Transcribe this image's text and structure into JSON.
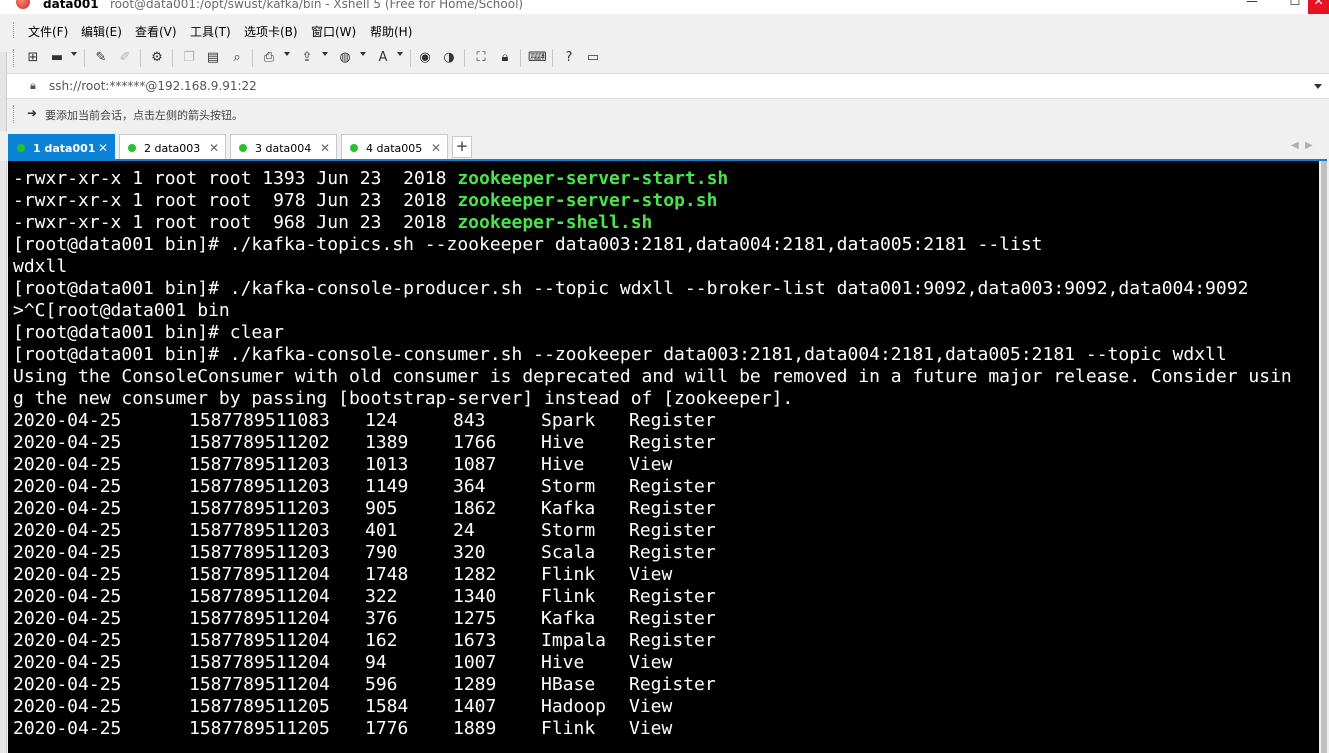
{
  "window": {
    "session_name": "data001",
    "title": "root@data001:/opt/swust/kafka/bin - Xshell 5 (Free for Home/School)",
    "min_label": "—",
    "max_label": "☐",
    "close_label": "✕"
  },
  "menu": [
    "文件(F)",
    "编辑(E)",
    "查看(V)",
    "工具(T)",
    "选项卡(B)",
    "窗口(W)",
    "帮助(H)"
  ],
  "toolbar_icons": [
    "new-session-icon",
    "open-folder-icon",
    "connect-icon",
    "disconnect-icon",
    "session-properties-icon",
    "copy-icon",
    "paste-icon",
    "find-icon",
    "print-icon",
    "transfer-icon",
    "globe-icon",
    "font-icon",
    "script-icon",
    "record-icon",
    "fullscreen-icon",
    "lock-icon",
    "keyboard-icon",
    "help-icon",
    "chat-icon"
  ],
  "address": {
    "value": "ssh://root:******@192.168.9.91:22"
  },
  "hint": {
    "text": "要添加当前会话，点击左侧的箭头按钮。"
  },
  "tabs": [
    {
      "label": "1 data001",
      "active": true
    },
    {
      "label": "2 data003",
      "active": false
    },
    {
      "label": "3 data004",
      "active": false
    },
    {
      "label": "4 data005",
      "active": false
    }
  ],
  "tab_close": "✕",
  "new_tab": "+",
  "terminal": {
    "ls_lines": [
      {
        "prefix": "-rwxr-xr-x 1 root root 1393 Jun 23  2018 ",
        "file": "zookeeper-server-start.sh"
      },
      {
        "prefix": "-rwxr-xr-x 1 root root  978 Jun 23  2018 ",
        "file": "zookeeper-server-stop.sh"
      },
      {
        "prefix": "-rwxr-xr-x 1 root root  968 Jun 23  2018 ",
        "file": "zookeeper-shell.sh"
      }
    ],
    "lines": [
      "[root@data001 bin]# ./kafka-topics.sh --zookeeper data003:2181,data004:2181,data005:2181 --list",
      "wdxll",
      "[root@data001 bin]# ./kafka-console-producer.sh --topic wdxll --broker-list data001:9092,data003:9092,data004:9092",
      ">^C[root@data001 bin",
      "[root@data001 bin]# clear",
      "[root@data001 bin]# ./kafka-console-consumer.sh --zookeeper data003:2181,data004:2181,data005:2181 --topic wdxll",
      "Using the ConsoleConsumer with old consumer is deprecated and will be removed in a future major release. Consider usin",
      "g the new consumer by passing [bootstrap-server] instead of [zookeeper]."
    ],
    "records": [
      [
        "2020-04-25",
        "1587789511083",
        "124",
        "843",
        "Spark",
        "Register"
      ],
      [
        "2020-04-25",
        "1587789511202",
        "1389",
        "1766",
        "Hive",
        "Register"
      ],
      [
        "2020-04-25",
        "1587789511203",
        "1013",
        "1087",
        "Hive",
        "View"
      ],
      [
        "2020-04-25",
        "1587789511203",
        "1149",
        "364",
        "Storm",
        "Register"
      ],
      [
        "2020-04-25",
        "1587789511203",
        "905",
        "1862",
        "Kafka",
        "Register"
      ],
      [
        "2020-04-25",
        "1587789511203",
        "401",
        "24",
        "Storm",
        "Register"
      ],
      [
        "2020-04-25",
        "1587789511203",
        "790",
        "320",
        "Scala",
        "Register"
      ],
      [
        "2020-04-25",
        "1587789511204",
        "1748",
        "1282",
        "Flink",
        "View"
      ],
      [
        "2020-04-25",
        "1587789511204",
        "322",
        "1340",
        "Flink",
        "Register"
      ],
      [
        "2020-04-25",
        "1587789511204",
        "376",
        "1275",
        "Kafka",
        "Register"
      ],
      [
        "2020-04-25",
        "1587789511204",
        "162",
        "1673",
        "Impala",
        "Register"
      ],
      [
        "2020-04-25",
        "1587789511204",
        "94",
        "1007",
        "Hive",
        "View"
      ],
      [
        "2020-04-25",
        "1587789511204",
        "596",
        "1289",
        "HBase",
        "Register"
      ],
      [
        "2020-04-25",
        "1587789511205",
        "1584",
        "1407",
        "Hadoop",
        "View"
      ],
      [
        "2020-04-25",
        "1587789511205",
        "1776",
        "1889",
        "Flink",
        "View"
      ]
    ]
  },
  "colors": {
    "terminal_bg": "#000000",
    "terminal_fg": "#ffffff",
    "exec_file": "#4be34b",
    "active_tab": "#0c82d6"
  }
}
